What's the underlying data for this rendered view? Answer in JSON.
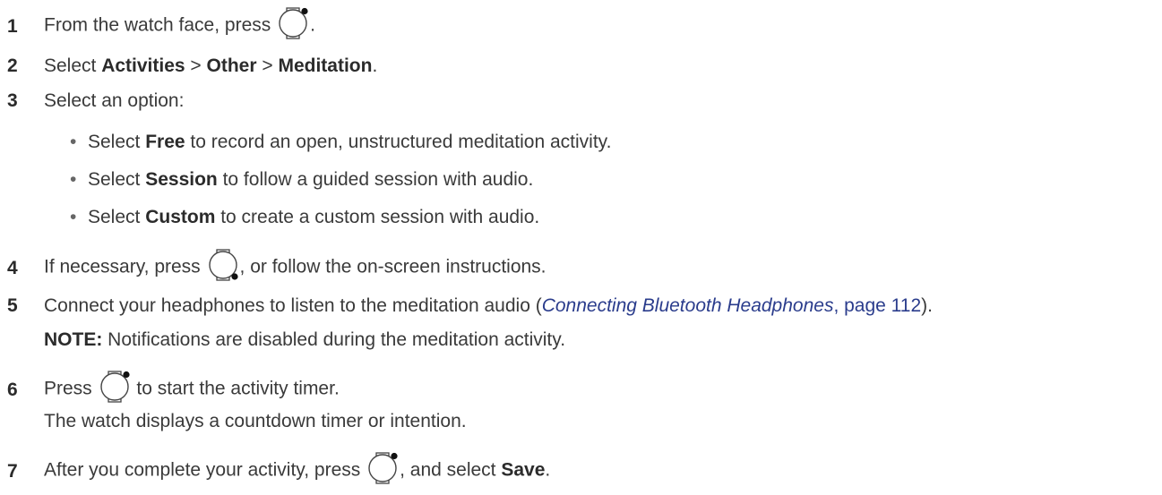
{
  "steps": [
    {
      "num": "1",
      "before": "From the watch face, press",
      "after": ".",
      "icon": "watch-start-button-icon"
    },
    {
      "num": "2",
      "pre": "Select ",
      "b1": "Activities",
      "s1": " > ",
      "b2": "Other",
      "s2": " > ",
      "b3": "Meditation",
      "post": "."
    },
    {
      "num": "3",
      "text": "Select an option:"
    },
    {
      "num": "4",
      "before": "If necessary, press",
      "after": ", or follow the on-screen instructions.",
      "icon": "watch-back-button-icon"
    },
    {
      "num": "5",
      "before": "Connect your headphones to listen to the meditation audio (",
      "link": "Connecting Bluetooth Headphones",
      "comma": ", ",
      "page": "page 112",
      "after": ")."
    },
    {
      "num": "6",
      "before": "Press",
      "after": "to start the activity timer.",
      "icon": "watch-start-button-icon"
    },
    {
      "num": "7",
      "before": "After you complete your activity, press",
      "after": ", and select ",
      "bold": "Save",
      "end": ".",
      "icon": "watch-start-button-icon"
    }
  ],
  "options": [
    {
      "pre": "Select ",
      "bold": "Free",
      "post": " to record an open, unstructured meditation activity."
    },
    {
      "pre": "Select ",
      "bold": "Session",
      "post": " to follow a guided session with audio."
    },
    {
      "pre": "Select ",
      "bold": "Custom",
      "post": " to create a custom session with audio."
    }
  ],
  "note": {
    "label": "NOTE:",
    "text": " Notifications are disabled during the meditation activity."
  },
  "step6_result": "The watch displays a countdown timer or intention.",
  "colors": {
    "text": "#3a3a3a",
    "link": "#2a3c8c"
  }
}
